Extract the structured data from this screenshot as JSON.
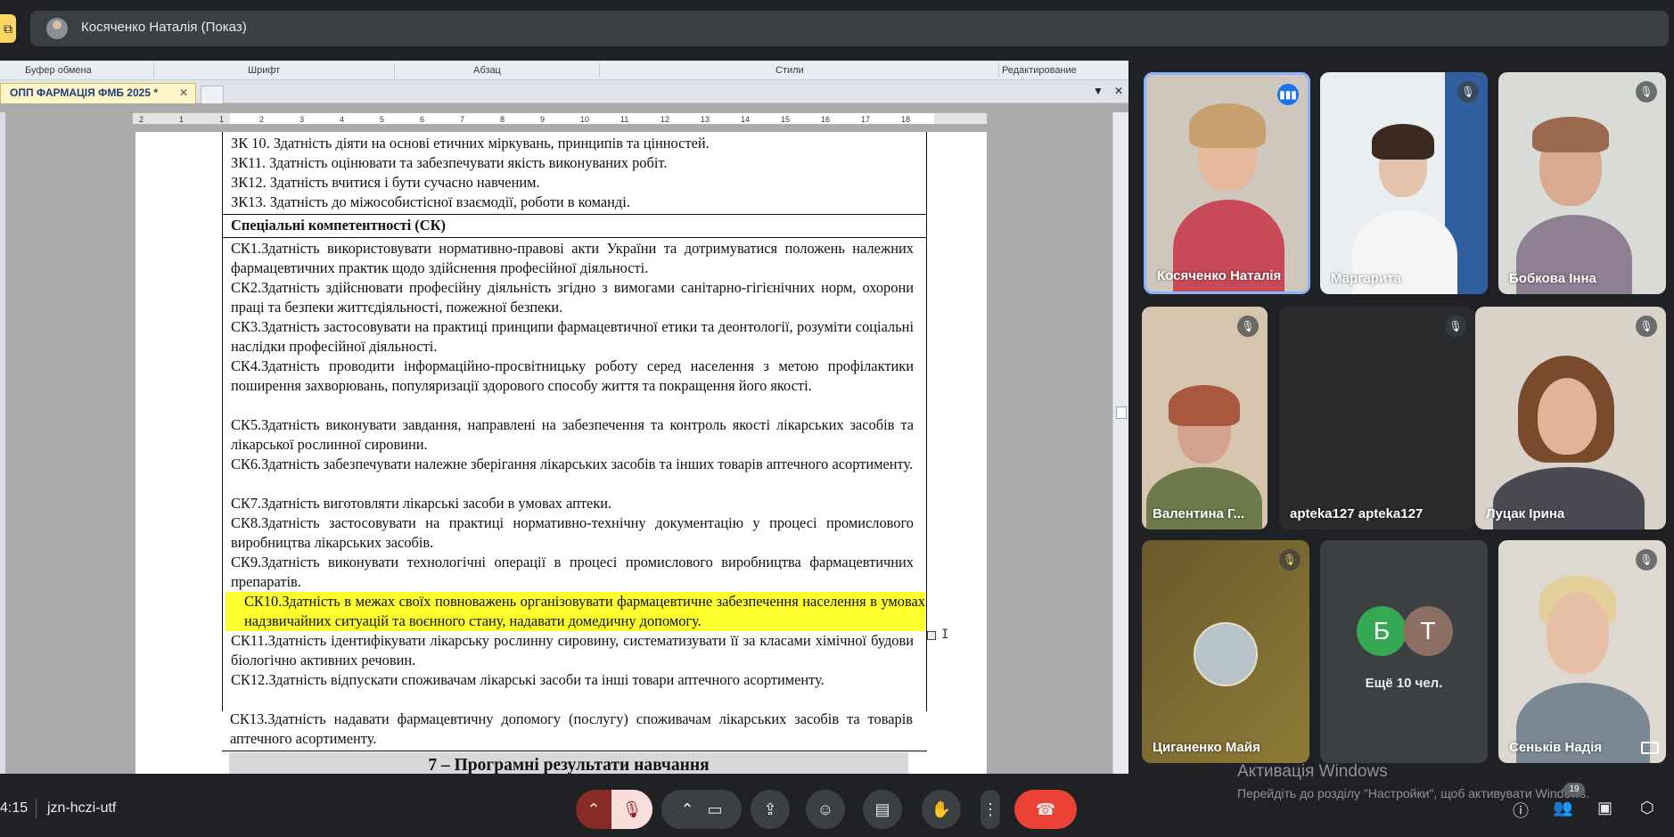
{
  "top_bar": {
    "presenter_label": "Косяченко Наталія (Показ)"
  },
  "word": {
    "ribbon_groups": [
      "Буфер обмена",
      "Шрифт",
      "Абзац",
      "Стили",
      "Редактирование"
    ],
    "doc_tab_title": "ОПП ФАРМАЦІЯ ФМБ 2025 *",
    "tab_close": "✕",
    "ruler_numbers": [
      "2",
      "1",
      "1",
      "2",
      "3",
      "4",
      "5",
      "6",
      "7",
      "8",
      "9",
      "10",
      "11",
      "12",
      "13",
      "14",
      "15",
      "16",
      "17",
      "18"
    ],
    "lines_zk": [
      "ЗК 10. Здатність діяти на основі етичних міркувань, принципів та цінностей.",
      "ЗК11. Здатність оцінювати та забезпечувати якість виконуваних робіт.",
      "ЗК12. Здатність вчитися і бути сучасно навченим.",
      "ЗК13. Здатність до міжособистісної взаємодії, роботи в команді."
    ],
    "sk_heading": "Спеціальні компетентності (СК)",
    "sk_items": [
      "СК1.Здатність використовувати нормативно-правові акти України та дотримуватися положень належних фармацевтичних практик щодо здійснення професійної діяльності.",
      "СК2.Здатність здійснювати професійну діяльність згідно з вимогами санітарно-гігієнічних норм, охорони праці та безпеки життєдіяльності, пожежної безпеки.",
      "СК3.Здатність застосовувати на практиці принципи фармацевтичної етики та деонтології, розуміти соціальні наслідки професійної діяльності.",
      "СК4.Здатність проводити інформаційно-просвітницьку роботу серед населення з метою профілактики поширення захворювань, популяризації здорового способу життя та покращення його якості.",
      "СК5.Здатність виконувати завдання, направлені на забезпечення та контроль якості лікарських засобів та лікарської рослинної сировини.",
      "СК6.Здатність забезпечувати належне зберігання лікарських засобів та інших товарів аптечного асортименту.",
      "СК7.Здатність виготовляти лікарські засоби в умовах аптеки.",
      "СК8.Здатність застосовувати на практиці нормативно-технічну документацію у процесі промислового виробництва лікарських засобів.",
      "СК9.Здатність виконувати технологічні операції в процесі промислового виробництва фармацевтичних препаратів.",
      "СК10.Здатність в межах своїх повноважень організовувати фармацевтичне забезпечення населення в умовах надзвичайних ситуацій та воєнного стану, надавати домедичну допомогу.",
      "СК11.Здатність ідентифікувати лікарську рослинну сировину, систематизувати її за класами хімічної будови біологічно активних речовин.",
      "СК12.Здатність відпускати споживачам лікарські засоби та інші товари аптечного асортименту.",
      "СК13.Здатність надавати фармацевтичну допомогу (послугу) споживачам лікарських засобів та товарів аптечного асортименту."
    ],
    "results_heading": "7 – Програмні результати навчання"
  },
  "participants": [
    {
      "name": "Косяченко Наталія",
      "mic": "speaking"
    },
    {
      "name": "Маргарита",
      "mic": "muted"
    },
    {
      "name": "Бобкова Інна",
      "mic": "muted"
    },
    {
      "name": "Валентина Г...",
      "mic": "muted"
    },
    {
      "name": "apteka127 apteka127",
      "mic": "muted"
    },
    {
      "name": "Луцак Ірина",
      "mic": "muted"
    },
    {
      "name": "Циганенко Майя",
      "mic": "muted"
    },
    {
      "name": "Сеньків Надія",
      "mic": "muted"
    }
  ],
  "more_tile": {
    "initials": [
      "Б",
      "Т"
    ],
    "label": "Ещё 10 чел.",
    "colors": [
      "#34a853",
      "#8d6e63"
    ]
  },
  "windows_watermark": {
    "title": "Активація Windows",
    "subtitle": "Перейдіть до розділу \"Настройки\", щоб активувати Windows."
  },
  "bottom_bar": {
    "clock": "4:15",
    "meeting_code": "jzn-hczi-utf",
    "participants_badge": "19"
  },
  "colors": {
    "accent": "#8ab4f8",
    "end_call": "#ea4335",
    "highlight": "#ffff2e"
  }
}
